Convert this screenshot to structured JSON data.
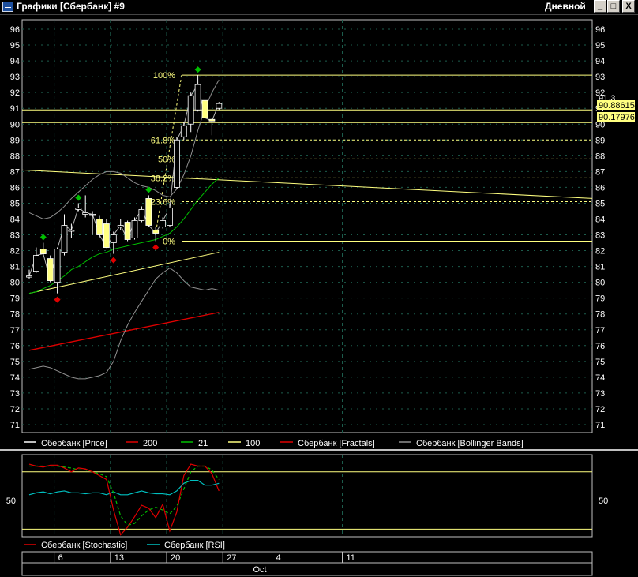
{
  "window": {
    "title": "Графики [Сбербанк] #9",
    "period": "Дневной",
    "min_glyph": "_",
    "max_glyph": "□",
    "close_glyph": "X"
  },
  "colors": {
    "candle_fill": "#ffff80",
    "price_line": "#ffffff",
    "ma200": "#e00000",
    "ma21": "#00c000",
    "ma100": "#ffff80",
    "fractal_up": "#00c000",
    "fractal_down": "#e00000",
    "bollinger": "#909090",
    "stochastic": "#e00000",
    "stochastic_signal": "#00c000",
    "rsi": "#00c0c0",
    "fib": "#ffff80"
  },
  "chart_data": [
    {
      "type": "candlestick",
      "y_ticks": [
        71,
        72,
        73,
        74,
        75,
        76,
        77,
        78,
        79,
        80,
        81,
        82,
        83,
        84,
        85,
        86,
        87,
        88,
        89,
        90,
        91,
        92,
        93,
        94,
        95,
        96
      ],
      "ylim": [
        70.5,
        96.6
      ],
      "grid": true,
      "x_ticks": [
        "6",
        "13",
        "20",
        "27",
        "4",
        "11"
      ],
      "month_label": "Oct",
      "candles": [
        {
          "o": 80.4,
          "h": 80.8,
          "l": 80.2,
          "c": 80.4
        },
        {
          "o": 80.7,
          "h": 82.2,
          "l": 80.6,
          "c": 81.7
        },
        {
          "o": 82.1,
          "h": 82.5,
          "l": 81.8,
          "c": 81.8
        },
        {
          "o": 81.5,
          "h": 81.7,
          "l": 80.0,
          "c": 80.1
        },
        {
          "o": 80.0,
          "h": 82.2,
          "l": 79.3,
          "c": 82.1
        },
        {
          "o": 81.9,
          "h": 84.3,
          "l": 81.7,
          "c": 83.6
        },
        {
          "o": 83.3,
          "h": 83.7,
          "l": 82.8,
          "c": 83.3
        },
        {
          "o": 84.6,
          "h": 85.0,
          "l": 84.5,
          "c": 84.7
        },
        {
          "o": 84.3,
          "h": 85.5,
          "l": 84.1,
          "c": 84.4
        },
        {
          "o": 84.3,
          "h": 84.5,
          "l": 83.0,
          "c": 84.3
        },
        {
          "o": 84.0,
          "h": 84.2,
          "l": 82.8,
          "c": 83.0
        },
        {
          "o": 83.7,
          "h": 84.0,
          "l": 82.2,
          "c": 82.2
        },
        {
          "o": 82.5,
          "h": 83.2,
          "l": 81.8,
          "c": 83.0
        },
        {
          "o": 83.5,
          "h": 84.0,
          "l": 83.3,
          "c": 83.6
        },
        {
          "o": 83.8,
          "h": 83.9,
          "l": 82.6,
          "c": 82.7
        },
        {
          "o": 82.8,
          "h": 84.1,
          "l": 82.7,
          "c": 83.9
        },
        {
          "o": 83.9,
          "h": 84.8,
          "l": 83.8,
          "c": 84.6
        },
        {
          "o": 85.3,
          "h": 85.5,
          "l": 83.5,
          "c": 83.6
        },
        {
          "o": 83.3,
          "h": 83.5,
          "l": 82.6,
          "c": 83.1
        },
        {
          "o": 83.5,
          "h": 84.1,
          "l": 83.4,
          "c": 83.9
        },
        {
          "o": 83.6,
          "h": 85.0,
          "l": 83.5,
          "c": 84.7
        },
        {
          "o": 86.0,
          "h": 89.2,
          "l": 85.9,
          "c": 89.0
        },
        {
          "o": 89.2,
          "h": 90.1,
          "l": 89.0,
          "c": 89.9
        },
        {
          "o": 90.0,
          "h": 92.0,
          "l": 89.5,
          "c": 91.8
        },
        {
          "o": 90.9,
          "h": 93.1,
          "l": 90.8,
          "c": 92.5
        },
        {
          "o": 91.5,
          "h": 91.7,
          "l": 90.3,
          "c": 90.4
        },
        {
          "o": 90.3,
          "h": 90.4,
          "l": 89.3,
          "c": 90.2
        },
        {
          "o": 91.0,
          "h": 91.4,
          "l": 90.9,
          "c": 91.3
        }
      ],
      "fractals_up": [
        2,
        7,
        17,
        24
      ],
      "fractals_down": [
        4,
        12,
        18
      ],
      "ma200": [
        75.7,
        78.1
      ],
      "ma100": [
        79.3,
        81.9
      ],
      "ma21": [
        79.3,
        79.4,
        79.6,
        79.8,
        80.1,
        80.4,
        80.8,
        81.0,
        81.3,
        81.6,
        81.8,
        81.9,
        82.1,
        82.2,
        82.3,
        82.4,
        82.5,
        82.6,
        82.7,
        82.9,
        83.1,
        83.5,
        84.0,
        84.6,
        85.2,
        85.7,
        86.2,
        86.6
      ],
      "boll_upper": [
        84.4,
        84.2,
        84.0,
        84.1,
        84.4,
        84.8,
        85.3,
        85.7,
        86.1,
        86.5,
        86.8,
        87.0,
        87.0,
        86.9,
        86.6,
        86.3,
        86.1,
        86.0,
        85.8,
        85.5,
        85.4,
        85.9,
        86.8,
        88.0,
        89.6,
        91.0,
        92.0,
        92.8
      ],
      "boll_lower": [
        74.5,
        74.6,
        74.7,
        74.6,
        74.4,
        74.2,
        74.0,
        73.9,
        73.9,
        74.0,
        74.1,
        74.3,
        75.0,
        76.3,
        77.3,
        78.1,
        78.8,
        79.5,
        80.2,
        80.6,
        80.9,
        80.6,
        80.1,
        79.7,
        79.6,
        79.5,
        79.6,
        79.5
      ],
      "fib_levels": [
        {
          "label": "100%",
          "value": 93.1
        },
        {
          "label": "61.8%",
          "value": 89.0
        },
        {
          "label": "50%",
          "value": 87.8
        },
        {
          "label": "38.2%",
          "value": 86.6
        },
        {
          "label": "23.6%",
          "value": 85.1
        },
        {
          "label": "0%",
          "value": 82.6
        }
      ],
      "horizontal_lines": [
        90.9,
        90.1
      ],
      "price_labels": [
        "91.3",
        "90.88615",
        "90.17976"
      ],
      "legend": [
        {
          "name": "Сбербанк [Price]",
          "color": "#ffffff"
        },
        {
          "name": "200",
          "color": "#e00000"
        },
        {
          "name": "21",
          "color": "#00c000"
        },
        {
          "name": "100",
          "color": "#ffff80"
        },
        {
          "name": "Сбербанк [Fractals]",
          "color": "#e00000"
        },
        {
          "name": "Сбербанк [Bollinger Bands]",
          "color": "#909090"
        }
      ]
    },
    {
      "type": "line",
      "y_ticks": [
        50
      ],
      "levels": [
        80,
        20
      ],
      "ylim": [
        12,
        98
      ],
      "stochastic_k": [
        88,
        86,
        85,
        87,
        87,
        84,
        80,
        84,
        83,
        80,
        76,
        72,
        40,
        14,
        22,
        33,
        45,
        42,
        32,
        46,
        18,
        38,
        76,
        88,
        86,
        86,
        78,
        60
      ],
      "stochastic_d": [
        86,
        86,
        86,
        86,
        86,
        85,
        84,
        82,
        82,
        80,
        78,
        75,
        58,
        34,
        24,
        26,
        34,
        40,
        43,
        40,
        36,
        44,
        62,
        80,
        86,
        86,
        82,
        72
      ],
      "rsi": [
        56,
        58,
        59,
        57,
        59,
        60,
        58,
        58,
        57,
        58,
        58,
        56,
        59,
        56,
        56,
        58,
        60,
        58,
        57,
        57,
        56,
        60,
        68,
        71,
        71,
        66,
        66,
        68
      ],
      "legend": [
        {
          "name": "Сбербанк [Stochastic]",
          "color": "#e00000"
        },
        {
          "name": "Сбербанк [RSI]",
          "color": "#00c0c0"
        }
      ]
    }
  ]
}
